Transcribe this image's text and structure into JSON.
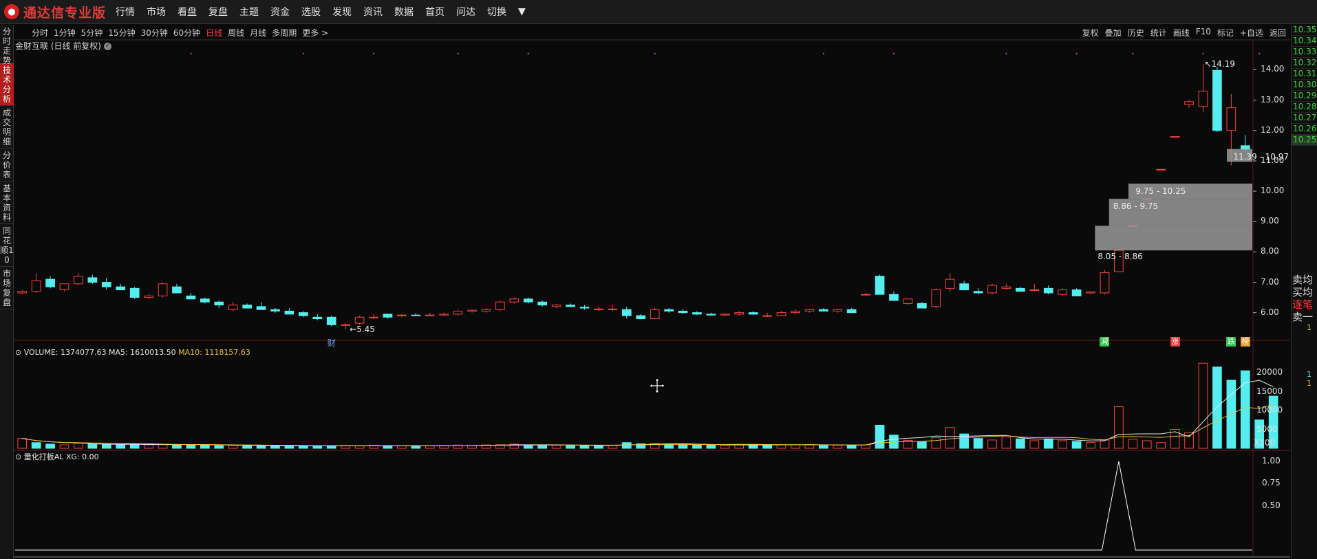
{
  "app": {
    "title": "通达信专业版",
    "logo": "tdx-logo"
  },
  "menu": [
    "行情",
    "市场",
    "看盘",
    "复盘",
    "主题",
    "资金",
    "选股",
    "发现",
    "资讯",
    "数据",
    "首页",
    "问达",
    "切换",
    "▼"
  ],
  "sidebar": [
    "分时走势",
    "技术分析",
    "成交明细",
    "分价表",
    "基本资料",
    "同花顺10",
    "市场复盘"
  ],
  "sidebar_active": 1,
  "toolbar": {
    "timeframes": [
      "分时",
      "1分钟",
      "5分钟",
      "15分钟",
      "30分钟",
      "60分钟",
      "日线",
      "周线",
      "月线",
      "多周期",
      "更多 >"
    ],
    "active_timeframe": 6,
    "right_items": [
      "复权",
      "叠加",
      "历史",
      "统计",
      "画线",
      "F10",
      "标记",
      "+自选",
      "返回"
    ]
  },
  "stock": {
    "title": "金财互联 (日线 前复权)",
    "info_icon": "info-icon"
  },
  "price_axis": [
    "14.00",
    "13.00",
    "12.00",
    "11.00",
    "10.00",
    "9.00",
    "8.00",
    "7.00",
    "6.00"
  ],
  "price_range": [
    5.2,
    14.6
  ],
  "annotations": {
    "high": "14.19",
    "low": "5.45",
    "low_tag": "财"
  },
  "chip_zones": [
    {
      "label": "11.39 - 10.97",
      "low": 10.97,
      "high": 11.39
    },
    {
      "label": "9.75 - 10.25",
      "low": 9.75,
      "high": 10.25
    },
    {
      "label": "8.86 - 9.75",
      "low": 8.86,
      "high": 9.75
    },
    {
      "label": "8.05 - 8.86",
      "low": 8.05,
      "high": 8.86
    }
  ],
  "event_tags": [
    {
      "text": "减",
      "color": "#2fbf4f"
    },
    {
      "text": "涨",
      "color": "#e23b3b"
    },
    {
      "text": "跌",
      "color": "#2fbf4f"
    },
    {
      "text": "榜",
      "color": "#e89a2a"
    }
  ],
  "volume": {
    "label": "VOLUME: 1374077.63",
    "ma5": "MA5: 1610013.50",
    "ma10": "MA10: 1118157.63",
    "axis": [
      "20000",
      "15000",
      "10000",
      "5000"
    ],
    "unit": "X100"
  },
  "indicator": {
    "label": "量化打板AL  XG: 0.00",
    "axis": [
      "1.00",
      "0.75",
      "0.50"
    ]
  },
  "right_panel": {
    "prices": [
      "10.35",
      "10.34",
      "10.33",
      "10.32",
      "10.31",
      "10.30",
      "10.29",
      "10.28",
      "10.27",
      "10.26",
      "10.25"
    ],
    "labels": [
      "卖均",
      "买均",
      "逐笔",
      "卖一"
    ],
    "nums": [
      "1",
      "1",
      "1"
    ]
  },
  "colors": {
    "up": "#ff4040",
    "down": "#55eef0",
    "grid": "#5a1a1a",
    "ma5": "#e8e8e8",
    "ma10": "#e8c23a"
  },
  "chart_data": {
    "type": "candlestick",
    "ohlc": [
      [
        6.65,
        6.75,
        6.6,
        6.7
      ],
      [
        6.7,
        7.3,
        6.65,
        7.05
      ],
      [
        7.1,
        7.2,
        6.8,
        6.85
      ],
      [
        6.75,
        6.95,
        6.7,
        6.95
      ],
      [
        6.95,
        7.3,
        6.9,
        7.2
      ],
      [
        7.15,
        7.25,
        6.95,
        7.0
      ],
      [
        7.0,
        7.15,
        6.75,
        6.85
      ],
      [
        6.85,
        6.95,
        6.75,
        6.75
      ],
      [
        6.8,
        6.85,
        6.45,
        6.5
      ],
      [
        6.5,
        6.6,
        6.45,
        6.55
      ],
      [
        6.55,
        7.0,
        6.5,
        6.95
      ],
      [
        6.85,
        6.95,
        6.65,
        6.65
      ],
      [
        6.55,
        6.65,
        6.45,
        6.45
      ],
      [
        6.45,
        6.5,
        6.3,
        6.35
      ],
      [
        6.35,
        6.4,
        6.15,
        6.25
      ],
      [
        6.1,
        6.35,
        6.05,
        6.25
      ],
      [
        6.25,
        6.3,
        6.15,
        6.15
      ],
      [
        6.2,
        6.35,
        6.1,
        6.1
      ],
      [
        6.1,
        6.15,
        6.0,
        6.05
      ],
      [
        6.05,
        6.15,
        5.95,
        5.95
      ],
      [
        6.0,
        6.05,
        5.85,
        5.9
      ],
      [
        5.85,
        5.95,
        5.75,
        5.8
      ],
      [
        5.85,
        5.9,
        5.55,
        5.6
      ],
      [
        5.6,
        5.65,
        5.45,
        5.6
      ],
      [
        5.65,
        5.9,
        5.6,
        5.85
      ],
      [
        5.85,
        5.95,
        5.8,
        5.85
      ],
      [
        5.95,
        5.95,
        5.8,
        5.85
      ],
      [
        5.9,
        5.95,
        5.85,
        5.92
      ],
      [
        5.92,
        5.98,
        5.88,
        5.9
      ],
      [
        5.9,
        6.0,
        5.88,
        5.92
      ],
      [
        5.92,
        6.0,
        5.9,
        5.95
      ],
      [
        5.95,
        6.1,
        5.9,
        6.05
      ],
      [
        6.05,
        6.1,
        6.0,
        6.08
      ],
      [
        6.05,
        6.15,
        6.0,
        6.1
      ],
      [
        6.1,
        6.4,
        6.05,
        6.35
      ],
      [
        6.35,
        6.5,
        6.3,
        6.45
      ],
      [
        6.45,
        6.5,
        6.3,
        6.35
      ],
      [
        6.35,
        6.4,
        6.2,
        6.25
      ],
      [
        6.2,
        6.28,
        6.15,
        6.25
      ],
      [
        6.25,
        6.3,
        6.18,
        6.2
      ],
      [
        6.18,
        6.25,
        6.1,
        6.15
      ],
      [
        6.12,
        6.2,
        6.05,
        6.12
      ],
      [
        6.1,
        6.25,
        6.05,
        6.12
      ],
      [
        6.1,
        6.2,
        5.8,
        5.9
      ],
      [
        5.9,
        5.95,
        5.78,
        5.8
      ],
      [
        5.8,
        6.15,
        5.78,
        6.1
      ],
      [
        6.1,
        6.15,
        6.0,
        6.05
      ],
      [
        6.05,
        6.12,
        5.95,
        6.0
      ],
      [
        6.0,
        6.05,
        5.92,
        5.95
      ],
      [
        5.95,
        6.0,
        5.9,
        5.92
      ],
      [
        5.92,
        5.98,
        5.88,
        5.95
      ],
      [
        5.95,
        6.05,
        5.9,
        6.0
      ],
      [
        6.0,
        6.05,
        5.92,
        5.95
      ],
      [
        5.9,
        6.0,
        5.85,
        5.9
      ],
      [
        5.9,
        6.05,
        5.88,
        6.0
      ],
      [
        6.0,
        6.1,
        5.95,
        6.05
      ],
      [
        6.05,
        6.12,
        6.0,
        6.1
      ],
      [
        6.1,
        6.15,
        6.05,
        6.05
      ],
      [
        6.05,
        6.12,
        6.0,
        6.1
      ],
      [
        6.1,
        6.15,
        6.0,
        6.0
      ],
      [
        6.6,
        6.65,
        6.6,
        6.6
      ],
      [
        7.2,
        7.25,
        6.6,
        6.6
      ],
      [
        6.6,
        6.7,
        6.4,
        6.4
      ],
      [
        6.3,
        6.45,
        6.25,
        6.45
      ],
      [
        6.3,
        6.35,
        6.15,
        6.15
      ],
      [
        6.2,
        6.8,
        6.15,
        6.75
      ],
      [
        6.8,
        7.3,
        6.7,
        7.1
      ],
      [
        6.95,
        7.05,
        6.75,
        6.75
      ],
      [
        6.7,
        6.8,
        6.6,
        6.65
      ],
      [
        6.65,
        6.95,
        6.6,
        6.9
      ],
      [
        6.8,
        6.95,
        6.75,
        6.85
      ],
      [
        6.8,
        6.85,
        6.7,
        6.7
      ],
      [
        6.75,
        6.95,
        6.7,
        6.75
      ],
      [
        6.8,
        6.9,
        6.6,
        6.65
      ],
      [
        6.6,
        6.8,
        6.55,
        6.75
      ],
      [
        6.75,
        6.8,
        6.55,
        6.55
      ],
      [
        6.65,
        6.7,
        6.6,
        6.68
      ],
      [
        6.65,
        7.4,
        6.6,
        7.32
      ],
      [
        7.35,
        8.05,
        7.35,
        8.05
      ],
      [
        8.86,
        8.86,
        8.86,
        8.86
      ],
      [
        9.75,
        9.75,
        9.75,
        9.75
      ],
      [
        10.72,
        10.72,
        10.72,
        10.72
      ],
      [
        11.8,
        11.8,
        11.8,
        11.8
      ],
      [
        12.85,
        13.0,
        12.75,
        12.95
      ],
      [
        12.8,
        14.19,
        12.6,
        13.3
      ],
      [
        13.98,
        14.1,
        11.95,
        12.0
      ],
      [
        12.0,
        13.2,
        10.85,
        12.75
      ],
      [
        11.5,
        11.85,
        11.3,
        11.38
      ]
    ],
    "volumes": [
      2600,
      1500,
      1100,
      900,
      1300,
      1100,
      1000,
      900,
      1000,
      950,
      1050,
      1000,
      900,
      850,
      700,
      750,
      700,
      650,
      600,
      700,
      600,
      650,
      700,
      750,
      700,
      800,
      650,
      700,
      650,
      700,
      750,
      850,
      800,
      900,
      950,
      1100,
      900,
      850,
      800,
      750,
      700,
      650,
      800,
      1500,
      1200,
      1300,
      1100,
      1000,
      900,
      850,
      800,
      900,
      1000,
      950,
      900,
      950,
      1000,
      850,
      800,
      750,
      900,
      6100,
      3500,
      2100,
      1700,
      2800,
      5500,
      3800,
      2600,
      2200,
      3000,
      2500,
      2000,
      2500,
      2000,
      1800,
      1500,
      2200,
      11000,
      2400,
      2000,
      1500,
      5000,
      4200,
      22500,
      21500,
      18000,
      20500,
      7500,
      13800
    ],
    "volume_up": [
      1,
      0,
      0,
      1,
      1,
      0,
      0,
      0,
      0,
      1,
      1,
      0,
      0,
      0,
      0,
      1,
      0,
      0,
      0,
      0,
      0,
      0,
      0,
      1,
      1,
      1,
      0,
      1,
      0,
      1,
      1,
      1,
      1,
      1,
      1,
      1,
      0,
      0,
      1,
      0,
      0,
      0,
      1,
      0,
      0,
      1,
      0,
      0,
      0,
      0,
      1,
      1,
      0,
      0,
      1,
      1,
      1,
      0,
      1,
      0,
      1,
      0,
      0,
      1,
      0,
      1,
      1,
      0,
      0,
      1,
      1,
      0,
      1,
      0,
      1,
      0,
      1,
      1,
      1,
      1,
      1,
      1,
      1,
      1,
      1,
      0,
      0,
      0,
      0,
      0
    ],
    "xg_signal_index": 78
  }
}
